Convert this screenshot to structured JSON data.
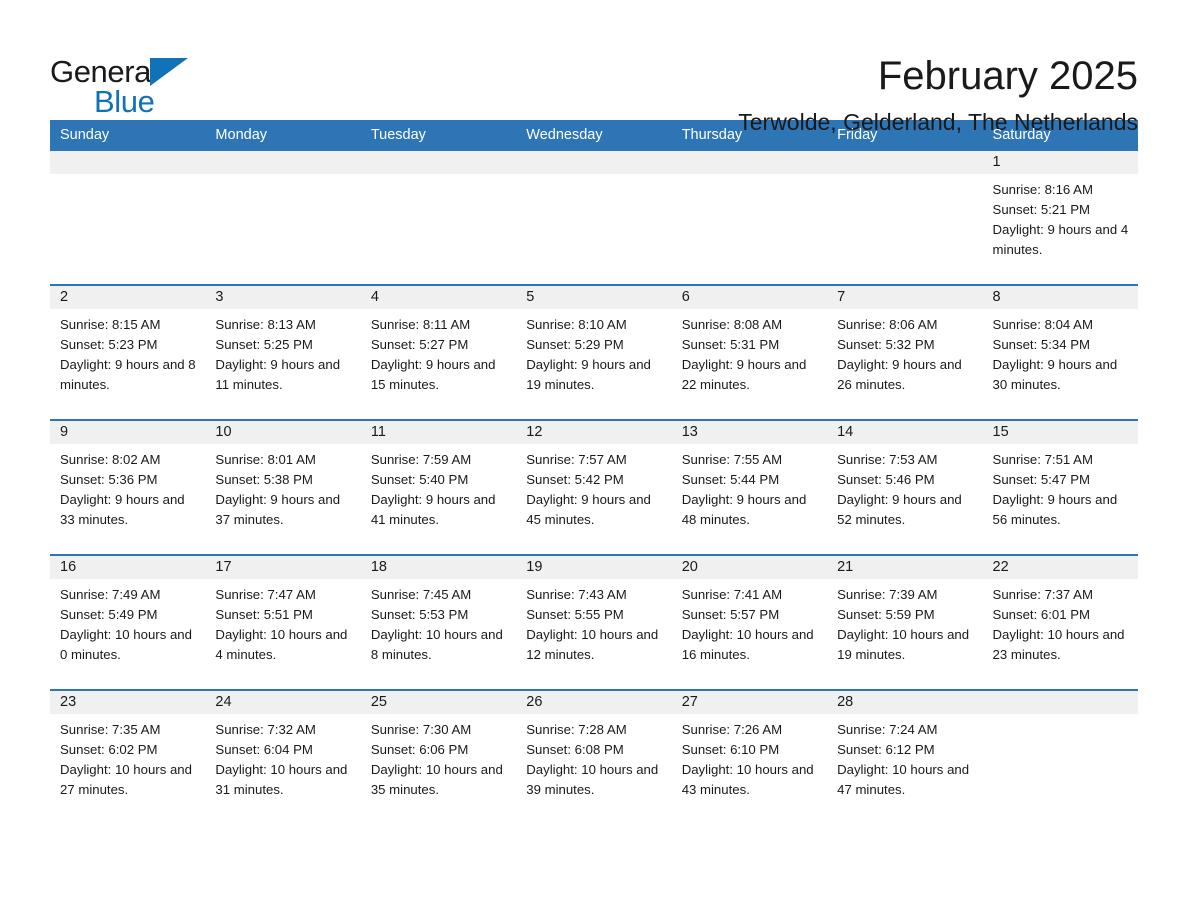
{
  "brand": {
    "name_top": "General",
    "name_bottom": "Blue",
    "triangle_icon": "brand-triangle-icon",
    "accent_color": "#1272b8"
  },
  "header": {
    "month_title": "February 2025",
    "location": "Terwolde, Gelderland, The Netherlands"
  },
  "theme": {
    "header_blue": "#2e75b6",
    "daynum_band": "#f0f0f0",
    "text": "#1a1a1a"
  },
  "calendar": {
    "weekday_headers": [
      "Sunday",
      "Monday",
      "Tuesday",
      "Wednesday",
      "Thursday",
      "Friday",
      "Saturday"
    ],
    "weeks": [
      [
        {
          "day": "",
          "sunrise": "",
          "sunset": "",
          "daylight": ""
        },
        {
          "day": "",
          "sunrise": "",
          "sunset": "",
          "daylight": ""
        },
        {
          "day": "",
          "sunrise": "",
          "sunset": "",
          "daylight": ""
        },
        {
          "day": "",
          "sunrise": "",
          "sunset": "",
          "daylight": ""
        },
        {
          "day": "",
          "sunrise": "",
          "sunset": "",
          "daylight": ""
        },
        {
          "day": "",
          "sunrise": "",
          "sunset": "",
          "daylight": ""
        },
        {
          "day": "1",
          "sunrise": "Sunrise: 8:16 AM",
          "sunset": "Sunset: 5:21 PM",
          "daylight": "Daylight: 9 hours and 4 minutes."
        }
      ],
      [
        {
          "day": "2",
          "sunrise": "Sunrise: 8:15 AM",
          "sunset": "Sunset: 5:23 PM",
          "daylight": "Daylight: 9 hours and 8 minutes."
        },
        {
          "day": "3",
          "sunrise": "Sunrise: 8:13 AM",
          "sunset": "Sunset: 5:25 PM",
          "daylight": "Daylight: 9 hours and 11 minutes."
        },
        {
          "day": "4",
          "sunrise": "Sunrise: 8:11 AM",
          "sunset": "Sunset: 5:27 PM",
          "daylight": "Daylight: 9 hours and 15 minutes."
        },
        {
          "day": "5",
          "sunrise": "Sunrise: 8:10 AM",
          "sunset": "Sunset: 5:29 PM",
          "daylight": "Daylight: 9 hours and 19 minutes."
        },
        {
          "day": "6",
          "sunrise": "Sunrise: 8:08 AM",
          "sunset": "Sunset: 5:31 PM",
          "daylight": "Daylight: 9 hours and 22 minutes."
        },
        {
          "day": "7",
          "sunrise": "Sunrise: 8:06 AM",
          "sunset": "Sunset: 5:32 PM",
          "daylight": "Daylight: 9 hours and 26 minutes."
        },
        {
          "day": "8",
          "sunrise": "Sunrise: 8:04 AM",
          "sunset": "Sunset: 5:34 PM",
          "daylight": "Daylight: 9 hours and 30 minutes."
        }
      ],
      [
        {
          "day": "9",
          "sunrise": "Sunrise: 8:02 AM",
          "sunset": "Sunset: 5:36 PM",
          "daylight": "Daylight: 9 hours and 33 minutes."
        },
        {
          "day": "10",
          "sunrise": "Sunrise: 8:01 AM",
          "sunset": "Sunset: 5:38 PM",
          "daylight": "Daylight: 9 hours and 37 minutes."
        },
        {
          "day": "11",
          "sunrise": "Sunrise: 7:59 AM",
          "sunset": "Sunset: 5:40 PM",
          "daylight": "Daylight: 9 hours and 41 minutes."
        },
        {
          "day": "12",
          "sunrise": "Sunrise: 7:57 AM",
          "sunset": "Sunset: 5:42 PM",
          "daylight": "Daylight: 9 hours and 45 minutes."
        },
        {
          "day": "13",
          "sunrise": "Sunrise: 7:55 AM",
          "sunset": "Sunset: 5:44 PM",
          "daylight": "Daylight: 9 hours and 48 minutes."
        },
        {
          "day": "14",
          "sunrise": "Sunrise: 7:53 AM",
          "sunset": "Sunset: 5:46 PM",
          "daylight": "Daylight: 9 hours and 52 minutes."
        },
        {
          "day": "15",
          "sunrise": "Sunrise: 7:51 AM",
          "sunset": "Sunset: 5:47 PM",
          "daylight": "Daylight: 9 hours and 56 minutes."
        }
      ],
      [
        {
          "day": "16",
          "sunrise": "Sunrise: 7:49 AM",
          "sunset": "Sunset: 5:49 PM",
          "daylight": "Daylight: 10 hours and 0 minutes."
        },
        {
          "day": "17",
          "sunrise": "Sunrise: 7:47 AM",
          "sunset": "Sunset: 5:51 PM",
          "daylight": "Daylight: 10 hours and 4 minutes."
        },
        {
          "day": "18",
          "sunrise": "Sunrise: 7:45 AM",
          "sunset": "Sunset: 5:53 PM",
          "daylight": "Daylight: 10 hours and 8 minutes."
        },
        {
          "day": "19",
          "sunrise": "Sunrise: 7:43 AM",
          "sunset": "Sunset: 5:55 PM",
          "daylight": "Daylight: 10 hours and 12 minutes."
        },
        {
          "day": "20",
          "sunrise": "Sunrise: 7:41 AM",
          "sunset": "Sunset: 5:57 PM",
          "daylight": "Daylight: 10 hours and 16 minutes."
        },
        {
          "day": "21",
          "sunrise": "Sunrise: 7:39 AM",
          "sunset": "Sunset: 5:59 PM",
          "daylight": "Daylight: 10 hours and 19 minutes."
        },
        {
          "day": "22",
          "sunrise": "Sunrise: 7:37 AM",
          "sunset": "Sunset: 6:01 PM",
          "daylight": "Daylight: 10 hours and 23 minutes."
        }
      ],
      [
        {
          "day": "23",
          "sunrise": "Sunrise: 7:35 AM",
          "sunset": "Sunset: 6:02 PM",
          "daylight": "Daylight: 10 hours and 27 minutes."
        },
        {
          "day": "24",
          "sunrise": "Sunrise: 7:32 AM",
          "sunset": "Sunset: 6:04 PM",
          "daylight": "Daylight: 10 hours and 31 minutes."
        },
        {
          "day": "25",
          "sunrise": "Sunrise: 7:30 AM",
          "sunset": "Sunset: 6:06 PM",
          "daylight": "Daylight: 10 hours and 35 minutes."
        },
        {
          "day": "26",
          "sunrise": "Sunrise: 7:28 AM",
          "sunset": "Sunset: 6:08 PM",
          "daylight": "Daylight: 10 hours and 39 minutes."
        },
        {
          "day": "27",
          "sunrise": "Sunrise: 7:26 AM",
          "sunset": "Sunset: 6:10 PM",
          "daylight": "Daylight: 10 hours and 43 minutes."
        },
        {
          "day": "28",
          "sunrise": "Sunrise: 7:24 AM",
          "sunset": "Sunset: 6:12 PM",
          "daylight": "Daylight: 10 hours and 47 minutes."
        },
        {
          "day": "",
          "sunrise": "",
          "sunset": "",
          "daylight": ""
        }
      ]
    ]
  }
}
